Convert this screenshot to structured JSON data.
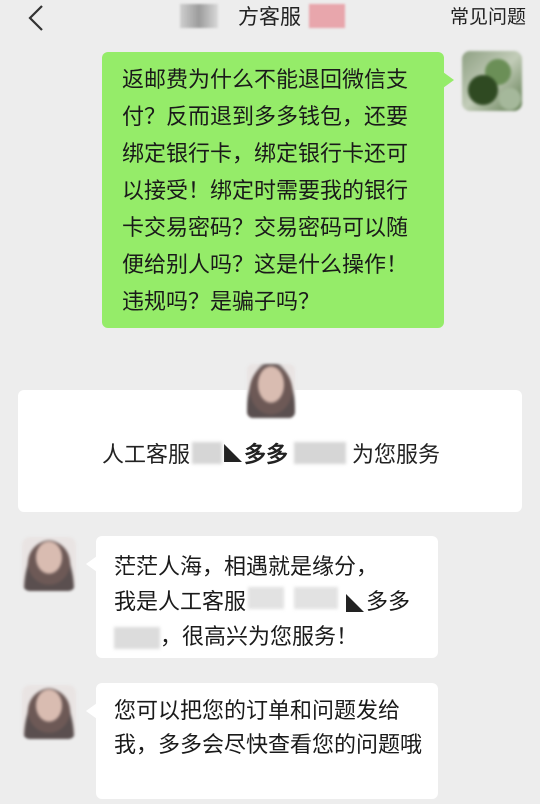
{
  "header": {
    "title": "方客服",
    "faq_label": "常见问题"
  },
  "messages": {
    "user_message": "返邮费为什么不能退回微信支付？反而退到多多钱包，还要绑定银行卡，绑定银行卡还可以接受！绑定时需要我的银行卡交易密码？交易密码可以随便给别人吗？这是什么操作！违规吗？是骗子吗？",
    "agent_card": {
      "prefix": "人工客服",
      "name_fragment": "多多",
      "suffix": "为您服务"
    },
    "agent_msg_1": {
      "line1": "茫茫人海，相遇就是缘分，",
      "line2_prefix": "我是人工客服",
      "line2_name": "多多",
      "line3": "，很高兴为您服务！"
    },
    "agent_msg_2": "您可以把您的订单和问题发给我，多多会尽快查看您的问题哦"
  },
  "icons": {
    "back": "chevron-left-icon"
  },
  "colors": {
    "background": "#ededed",
    "user_bubble": "#95ec69",
    "agent_bubble": "#ffffff"
  }
}
